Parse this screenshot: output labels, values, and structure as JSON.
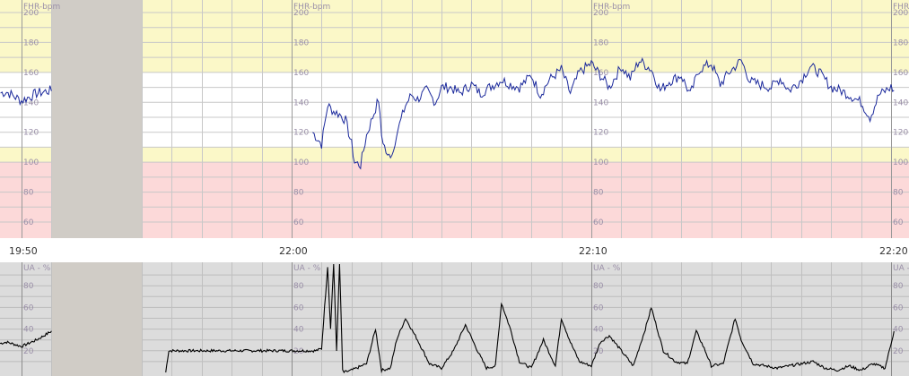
{
  "time_labels": [
    "19:50",
    "22:00",
    "22:10",
    "22:20"
  ],
  "colors": {
    "fhr_bg": "#ffffff",
    "fhr_normal_band": "#ffffff",
    "fhr_caution_band": "#fbf8c8",
    "fhr_alert_band": "#fcd9d9",
    "ua_bg": "#dcdcdc",
    "gap": "#d0ccc6",
    "grid": "#c8c8c8",
    "major_grid": "#9a9a9a",
    "fhr_trace": "#1c2a9c",
    "ua_trace": "#000000",
    "label": "#9a8fa8"
  },
  "chart_data": [
    {
      "type": "line",
      "title": "",
      "ylabel": "FHR-bpm",
      "ylim": [
        50,
        200
      ],
      "yticks": [
        60,
        80,
        100,
        120,
        140,
        160,
        180,
        200
      ],
      "bands": {
        "normal": [
          110,
          160
        ],
        "caution_low": [
          100,
          110
        ],
        "caution_high": [
          160,
          200
        ],
        "alert": [
          50,
          100
        ]
      },
      "series": [
        {
          "segment": "19:50",
          "x_minutes": [
            0,
            0.5,
            1,
            1.5,
            2,
            2.5,
            3,
            3.5
          ],
          "y": [
            145,
            147,
            141,
            146,
            148,
            150,
            146,
            148
          ]
        },
        {
          "segment": "22:00",
          "x_minutes": [
            0.7,
            1.0,
            1.2,
            1.4,
            1.6,
            1.8,
            2.0,
            2.1,
            2.3,
            2.5,
            2.7,
            2.9,
            3.0,
            3.2,
            3.4,
            3.5,
            3.6,
            3.8,
            4.0,
            4.2,
            4.5,
            4.8,
            5.0,
            5.3,
            5.6,
            6.0,
            6.3,
            6.6,
            7.0,
            7.3,
            7.6,
            8.0,
            8.3,
            8.6,
            9.0,
            9.3,
            9.6,
            10.0,
            10.3,
            10.6,
            11.0,
            11.3,
            11.6,
            12.0,
            12.3,
            12.6,
            13.0,
            13.3,
            13.6,
            14.0,
            14.3,
            14.6,
            15.0,
            15.3,
            15.6,
            16.0,
            16.3,
            16.6,
            17.0,
            17.3,
            17.6,
            18.0,
            18.3,
            18.6,
            19.0,
            19.3,
            19.6,
            20.0,
            20.1
          ],
          "y": [
            120,
            112,
            138,
            134,
            132,
            128,
            112,
            100,
            98,
            118,
            130,
            142,
            118,
            103,
            108,
            120,
            125,
            138,
            145,
            142,
            148,
            140,
            150,
            150,
            146,
            152,
            146,
            150,
            155,
            152,
            150,
            158,
            145,
            155,
            162,
            146,
            160,
            166,
            158,
            150,
            164,
            156,
            168,
            162,
            148,
            154,
            158,
            145,
            162,
            166,
            152,
            160,
            168,
            154,
            152,
            150,
            156,
            148,
            155,
            164,
            160,
            150,
            148,
            145,
            140,
            130,
            145,
            150,
            148
          ]
        }
      ]
    },
    {
      "type": "line",
      "title": "",
      "ylabel": "UA - %",
      "ylim": [
        0,
        100
      ],
      "yticks": [
        20,
        40,
        60,
        80
      ],
      "series": [
        {
          "segment": "19:50",
          "x_minutes": [
            0,
            0.5,
            1,
            1.5,
            2,
            2.5,
            3,
            3.5
          ],
          "y": [
            25,
            28,
            24,
            30,
            38,
            50,
            45,
            32
          ]
        },
        {
          "segment": "22:00",
          "x_minutes": [
            -4.2,
            -4.1,
            -4.0,
            0.8,
            1.0,
            1.1,
            1.2,
            1.3,
            1.4,
            1.5,
            1.6,
            1.7,
            1.75,
            2.0,
            2.5,
            2.8,
            3.0,
            3.3,
            3.5,
            3.8,
            4.2,
            4.6,
            5.0,
            5.4,
            5.8,
            6.2,
            6.5,
            6.8,
            7.0,
            7.3,
            7.6,
            8.0,
            8.4,
            8.8,
            9.0,
            9.3,
            9.6,
            10.0,
            10.3,
            10.6,
            11.0,
            11.4,
            11.8,
            12.0,
            12.4,
            12.8,
            13.2,
            13.5,
            13.8,
            14.0,
            14.4,
            14.8,
            15.0,
            15.4,
            15.8,
            16.2,
            16.6,
            17.0,
            17.4,
            17.8,
            18.2,
            18.6,
            19.0,
            19.4,
            19.8,
            20.1
          ],
          "y": [
            0,
            20,
            20,
            20,
            22,
            60,
            98,
            40,
            100,
            20,
            100,
            2,
            0,
            2,
            8,
            40,
            2,
            4,
            30,
            50,
            30,
            8,
            4,
            20,
            44,
            20,
            4,
            6,
            64,
            40,
            10,
            4,
            30,
            6,
            50,
            28,
            10,
            6,
            28,
            34,
            20,
            6,
            40,
            60,
            20,
            10,
            8,
            38,
            20,
            6,
            8,
            50,
            30,
            8,
            6,
            4,
            6,
            8,
            10,
            4,
            2,
            6,
            2,
            8,
            4,
            38
          ]
        }
      ]
    }
  ]
}
